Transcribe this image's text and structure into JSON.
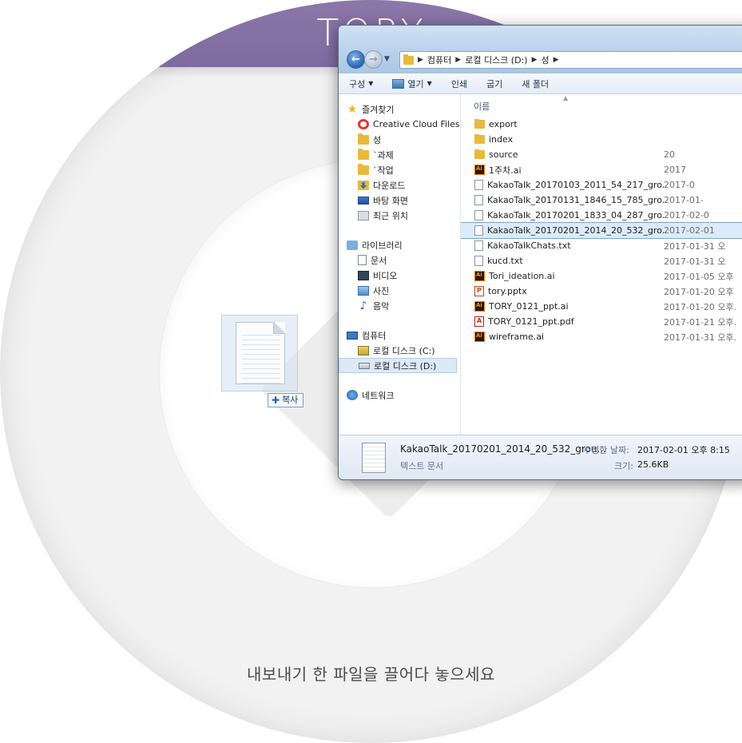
{
  "app": {
    "title": "TORY",
    "drop_hint": "내보내기 한 파일을 끌어다 놓으세요",
    "accent_color": "#8c77a8"
  },
  "drag": {
    "copy_badge": "복사"
  },
  "explorer": {
    "breadcrumb": [
      "컴퓨터",
      "로컬 디스크 (D:)",
      "성"
    ],
    "toolbar": {
      "organize": "구성",
      "open": "열기",
      "print": "인쇄",
      "burn": "굽기",
      "new_folder": "새 폴더"
    },
    "sidebar": {
      "favorites_header": "즐겨찾기",
      "favorites": [
        "Creative Cloud Files",
        "성",
        "`과제",
        "`작업",
        "다운로드",
        "바탕 화면",
        "최근 위치"
      ],
      "libraries_header": "라이브러리",
      "libraries": [
        "문서",
        "비디오",
        "사진",
        "음악"
      ],
      "computer_header": "컴퓨터",
      "drives": [
        "로컬 디스크 (C:)",
        "로컬 디스크 (D:)"
      ],
      "network_header": "네트워크"
    },
    "column_header": "이름",
    "files": [
      {
        "name": "export",
        "date": "",
        "icon": "folder"
      },
      {
        "name": "index",
        "date": "",
        "icon": "folder"
      },
      {
        "name": "source",
        "date": "20",
        "icon": "folder"
      },
      {
        "name": "1주차.ai",
        "date": "2017",
        "icon": "ai"
      },
      {
        "name": "KakaoTalk_20170103_2011_54_217_gro...",
        "date": "2017-0",
        "icon": "txt"
      },
      {
        "name": "KakaoTalk_20170131_1846_15_785_gro...",
        "date": "2017-01-",
        "icon": "txt"
      },
      {
        "name": "KakaoTalk_20170201_1833_04_287_gro...",
        "date": "2017-02-0",
        "icon": "txt"
      },
      {
        "name": "KakaoTalk_20170201_2014_20_532_gro...",
        "date": "2017-02-01",
        "icon": "txt",
        "selected": true
      },
      {
        "name": "KakaoTalkChats.txt",
        "date": "2017-01-31 오",
        "icon": "txt"
      },
      {
        "name": "kucd.txt",
        "date": "2017-01-31 오",
        "icon": "txt"
      },
      {
        "name": "Tori_ideation.ai",
        "date": "2017-01-05 오후",
        "icon": "ai"
      },
      {
        "name": "tory.pptx",
        "date": "2017-01-20 오후",
        "icon": "pptx"
      },
      {
        "name": "TORY_0121_ppt.ai",
        "date": "2017-01-20 오후.",
        "icon": "ai"
      },
      {
        "name": "TORY_0121_ppt.pdf",
        "date": "2017-01-21 오후.",
        "icon": "pdf"
      },
      {
        "name": "wireframe.ai",
        "date": "2017-01-31 오후.",
        "icon": "ai"
      }
    ],
    "details": {
      "name": "KakaoTalk_20170201_2014_20_532_grou...",
      "type": "텍스트 문서",
      "modified_label": "수정한 날짜:",
      "modified": "2017-02-01 오후 8:15",
      "size_label": "크기:",
      "size": "25.6KB"
    }
  }
}
